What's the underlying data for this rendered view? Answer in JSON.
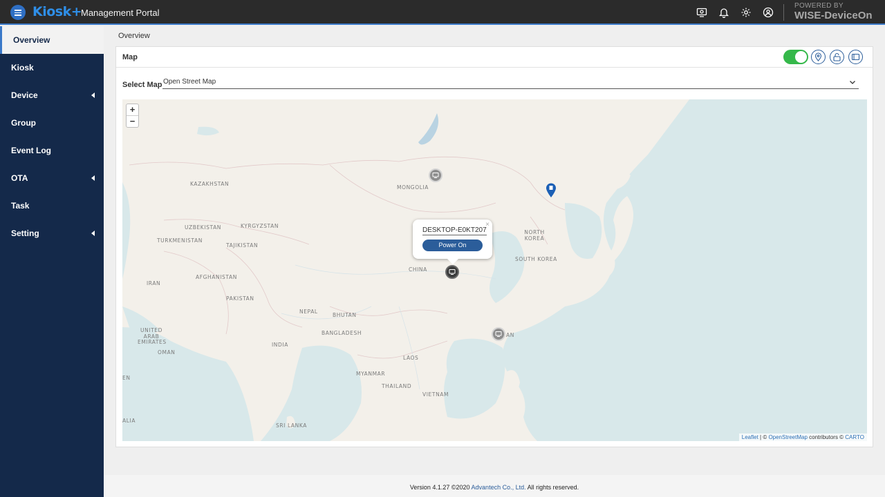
{
  "header": {
    "brand": "Kiosk+",
    "title": "Management Portal",
    "powered_by": "POWERED BY",
    "product": "WISE-DeviceOn",
    "icons": [
      "monitor-settings-icon",
      "bell-icon",
      "gear-icon",
      "user-circle-icon"
    ]
  },
  "sidebar": {
    "items": [
      {
        "label": "Overview",
        "active": true,
        "expandable": false
      },
      {
        "label": "Kiosk",
        "active": false,
        "expandable": false
      },
      {
        "label": "Device",
        "active": false,
        "expandable": true
      },
      {
        "label": "Group",
        "active": false,
        "expandable": false
      },
      {
        "label": "Event Log",
        "active": false,
        "expandable": false
      },
      {
        "label": "OTA",
        "active": false,
        "expandable": true
      },
      {
        "label": "Task",
        "active": false,
        "expandable": false
      },
      {
        "label": "Setting",
        "active": false,
        "expandable": true
      }
    ]
  },
  "breadcrumb": "Overview",
  "map_panel": {
    "title": "Map",
    "toggle_on": true,
    "toggle_color": "#35b84a",
    "select_label": "Select Map",
    "select_value": "Open Street Map",
    "zoom_in": "+",
    "zoom_out": "−",
    "countries": [
      "KAZAKHSTAN",
      "MONGOLIA",
      "UZBEKISTAN",
      "KYRGYZSTAN",
      "TURKMENISTAN",
      "TAJIKISTAN",
      "NORTH KOREA",
      "SOUTH KOREA",
      "CHINA",
      "IRAN",
      "AFGHANISTAN",
      "PAKISTAN",
      "NEPAL",
      "BHUTAN",
      "UNITED ARAB EMIRATES",
      "OMAN",
      "INDIA",
      "BANGLADESH",
      "LAOS",
      "MYANMAR",
      "THAILAND",
      "VIETNAM",
      "SRI LANKA",
      "AN",
      "EN",
      "ALIA"
    ],
    "popup": {
      "device_name": "DESKTOP-E0KT207",
      "button": "Power On",
      "close": "×"
    },
    "attribution": {
      "leaflet": "Leaflet",
      "sep": " | © ",
      "osm": "OpenStreetMap",
      "contributors": " contributors © ",
      "carto": "CARTO"
    }
  },
  "footer": {
    "version": "Version 4.1.27 ©2020 ",
    "company": "Advantech Co., Ltd.",
    "rights": " All rights reserved."
  }
}
